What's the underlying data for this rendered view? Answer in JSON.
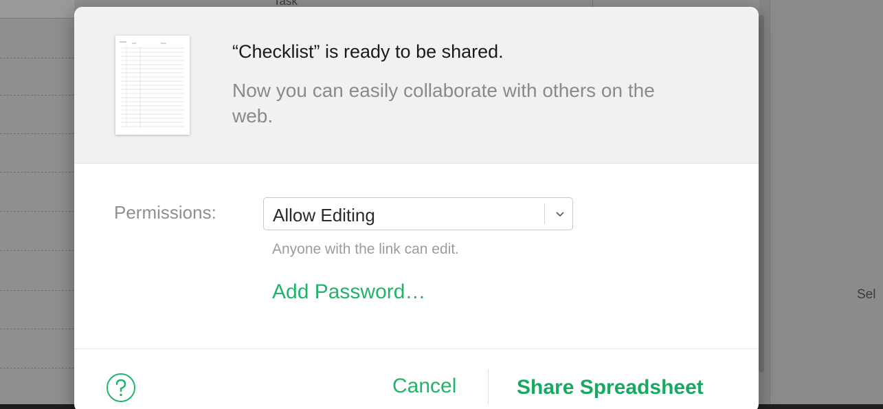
{
  "background": {
    "column_header": "Task",
    "right_panel_text": "Sel"
  },
  "dialog": {
    "headline": "“Checklist” is ready to be shared.",
    "subline": "Now you can easily collaborate with others on the web.",
    "thumbnail_icon": "spreadsheet-thumbnail",
    "permissions": {
      "label": "Permissions:",
      "selected_value": "Allow Editing",
      "help_text": "Anyone with the link can edit."
    },
    "add_password_label": "Add Password…",
    "footer": {
      "help_icon": "question-circle-icon",
      "cancel_label": "Cancel",
      "share_label": "Share Spreadsheet"
    }
  },
  "colors": {
    "accent_green": "#20b46a",
    "header_bg": "#f1f1f1",
    "muted_text": "#8a8a8a"
  }
}
